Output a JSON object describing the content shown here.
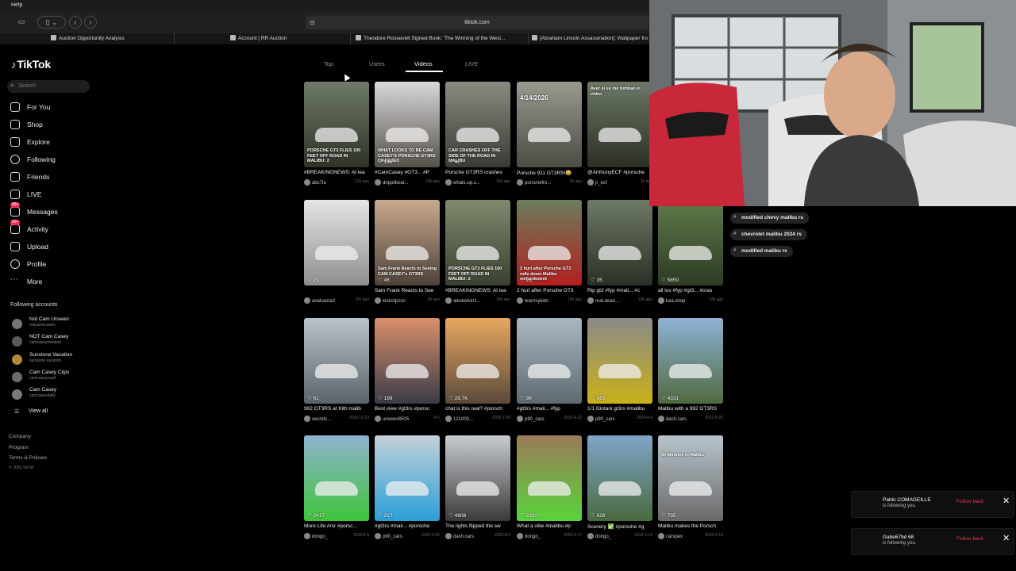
{
  "menubar": {
    "help_label": "Help"
  },
  "browser": {
    "url": "tiktok.com",
    "tabs": [
      {
        "label": "Auction Opportunity Analysis"
      },
      {
        "label": "Account | RR Auction"
      },
      {
        "label": "Theodore Roosevelt Signed Book: 'The Winning of the West..."
      },
      {
        "label": "[Abraham Lincoln Assassination]: Wallpaper fro"
      }
    ]
  },
  "sidebar": {
    "logo": "TikTok",
    "search_placeholder": "Search",
    "nav": [
      {
        "label": "For You",
        "icon": "home-icon"
      },
      {
        "label": "Shop",
        "icon": "shop-icon"
      },
      {
        "label": "Explore",
        "icon": "compass-icon"
      },
      {
        "label": "Following",
        "icon": "following-avatar-icon"
      },
      {
        "label": "Friends",
        "icon": "friends-icon"
      },
      {
        "label": "LIVE",
        "icon": "live-icon"
      },
      {
        "label": "Messages",
        "icon": "messages-icon",
        "badge": "99+"
      },
      {
        "label": "Activity",
        "icon": "activity-icon",
        "badge": "99+"
      },
      {
        "label": "Upload",
        "icon": "upload-icon"
      },
      {
        "label": "Profile",
        "icon": "profile-icon"
      },
      {
        "label": "More",
        "icon": "more-icon"
      }
    ],
    "following_title": "Following accounts",
    "accounts": [
      {
        "name": "Not Cam Unseen",
        "handle": "notcamunseen"
      },
      {
        "name": "NOT Cam Casey",
        "handle": "camcaseymindset"
      },
      {
        "name": "Sunstone Vacation",
        "handle": "sunstone.vacation"
      },
      {
        "name": "Cam Casey Clips",
        "handle": "camcaseyvault"
      },
      {
        "name": "Cam Casey",
        "handle": "camcaseydaily"
      }
    ],
    "view_all": "View all",
    "footer": {
      "company": "Company",
      "program": "Program",
      "terms": "Terms & Policies",
      "copyright": "© 2026 TikTok"
    }
  },
  "search_tabs": [
    "Top",
    "Users",
    "Videos",
    "LIVE"
  ],
  "active_tab": "Videos",
  "videos": [
    {
      "caption": "#BREAKINGNEWS: At lea",
      "user": "abc7la",
      "age": "21h ago",
      "likes": "",
      "overlay": "PORSCHE GT3 FLIES 100 FEET OFF ROAD IN MALIBU: 2",
      "c1": "#6f7a68",
      "c2": "#2e3328"
    },
    {
      "caption": "#CamCasey #GT3... #P",
      "user": "drippiibeat...",
      "age": "18h ago",
      "likes": "146",
      "overlay": "WHAT LOOKS TO BE CAM CASEY'S PORSCHE GT3RS CRASHED",
      "c1": "#d9d9d9",
      "c2": "#55504a"
    },
    {
      "caption": "Porsche GT3RS crashes",
      "user": "whats.up.s...",
      "age": "15h ago",
      "likes": "40",
      "overlay": "CAR CRASHES OFF THE SIDE OF THE ROAD IN MALIBU",
      "c1": "#8a8b80",
      "c2": "#3b3a34"
    },
    {
      "caption": "Porsche 911 GT3RS!😂",
      "user": "porschefro...",
      "age": "3h ago",
      "likes": "",
      "overlay": "4/14/2026",
      "c1": "#9a9a90",
      "c2": "#4c4b44"
    },
    {
      "caption": "@AnthonyECF #porsche",
      "user": "jr_ecf",
      "age": "1h ago",
      "likes": "",
      "overlay": "Aver si se me tumban el video",
      "c1": "#6d7966",
      "c2": "#2a2e24"
    },
    {
      "caption": "",
      "user": "analoazia2",
      "age": "15h ago",
      "likes": "29",
      "overlay": "",
      "c1": "#e5e5e5",
      "c2": "#8f8f8f"
    },
    {
      "caption": "Sam Frank Reacts to See",
      "user": "kickclipzsn",
      "age": "5h ago",
      "likes": "46",
      "overlay": "Sam Frank Reacts to Seeing CAM CASEY's GT3RS",
      "c1": "#c9a98e",
      "c2": "#4d4238"
    },
    {
      "caption": "#BREAKINGNEWS: At lea",
      "user": "alexkelvin1...",
      "age": "16h ago",
      "likes": "",
      "overlay": "PORSCHE GT3 FLIES 100 FEET OFF ROAD IN MALIBU: 2",
      "c1": "#7f8a6e",
      "c2": "#3a4030"
    },
    {
      "caption": "2 hurt after Porsche GT3",
      "user": "learnsykids",
      "age": "16h ago",
      "likes": "26",
      "overlay": "2 hurt after Porsche GT3 rolls down Malibu embankment",
      "c1": "#6a7d5c",
      "c2": "#b32020"
    },
    {
      "caption": "Rip gt3 #fyp #mali... #c",
      "user": "real.dean...",
      "age": "16h ago",
      "likes": "35",
      "overlay": "",
      "c1": "#6f7a66",
      "c2": "#2b3026"
    },
    {
      "caption": "all luv #fyp #gt3... #cras",
      "user": "kaa.shop",
      "age": "13h ago",
      "likes": "5850",
      "overlay": "",
      "c1": "#5f7a4a",
      "c2": "#2d3b24"
    },
    {
      "caption": "992 GT3RS at Kith malib",
      "user": "secretc...",
      "age": "2025-12-19",
      "likes": "61",
      "overlay": "",
      "c1": "#b9c2c9",
      "c2": "#5b646a"
    },
    {
      "caption": "Best view #gt3rs #porsc",
      "user": "unseen8505",
      "age": "4-5",
      "likes": "199",
      "overlay": "",
      "c1": "#d98f6b",
      "c2": "#3b3b48"
    },
    {
      "caption": "chat is this real? #porsch",
      "user": "121000...",
      "age": "2025-7-28",
      "likes": "28.7K",
      "overlay": "",
      "c1": "#e8a760",
      "c2": "#5a4a3c"
    },
    {
      "caption": "#gt3rs #mali... #fyp",
      "user": "p90_cars",
      "age": "2025-4-22",
      "likes": "98",
      "overlay": "",
      "c1": "#a8b8c4",
      "c2": "#5f6a70"
    },
    {
      "caption": "1/1 Gintani gt3rs #malibu",
      "user": "p90_cars",
      "age": "2024-4-9",
      "likes": "983",
      "overlay": "",
      "c1": "#8a8a8a",
      "c2": "#c9b11a"
    },
    {
      "caption": "Malibu with a 992 GT3RS",
      "user": "dash.cars",
      "age": "2023-5-26",
      "likes": "4331",
      "overlay": "",
      "c1": "#8fb2d6",
      "c2": "#4f6a3e"
    },
    {
      "caption": "More Life #rsr #porsc...",
      "user": "dongo_",
      "age": "2023-8-9",
      "likes": "2417",
      "overlay": "",
      "c1": "#8fb2d0",
      "c2": "#3ec43a"
    },
    {
      "caption": "#gt3rs #mali... #porsche",
      "user": "p90_cars",
      "age": "2025-3-20",
      "likes": "217",
      "overlay": "",
      "c1": "#c4d0d8",
      "c2": "#2a9fd8"
    },
    {
      "caption": "The lights flipped the sw",
      "user": "dash.cars",
      "age": "2023-8-3",
      "likes": "4808",
      "overlay": "",
      "c1": "#c8ccd0",
      "c2": "#3a3a3a"
    },
    {
      "caption": "What a vibe #malibu #p",
      "user": "dongo_",
      "age": "2023-4-17",
      "likes": "2332",
      "overlay": "",
      "c1": "#9a7a5a",
      "c2": "#5ad43a"
    },
    {
      "caption": "Scenery ✅ #porsche #g",
      "user": "dongo_",
      "age": "2022-11-6",
      "likes": "628",
      "overlay": "",
      "c1": "#7fa6c8",
      "c2": "#4a6a40"
    },
    {
      "caption": "Malibu makes the Porsch",
      "user": "carspex",
      "age": "2024-2-19",
      "likes": "735",
      "overlay": "30 Minutes in Malibu",
      "c1": "#b8c4cc",
      "c2": "#6a6a6a"
    }
  ],
  "suggestions": [
    "modified chevy malibu rs",
    "chevrolet malibu 2024 rs",
    "modified malibu rs"
  ],
  "notifications": [
    {
      "name": "Pablo COMAGEILLE",
      "sub": "is following you.",
      "action": "Follow back"
    },
    {
      "name": "Gabe67bd 68",
      "sub": "is following you.",
      "action": "Follow back"
    }
  ],
  "colors": {
    "accent": "#fe2c55",
    "background": "#000000",
    "surface": "#1e1e1e"
  }
}
